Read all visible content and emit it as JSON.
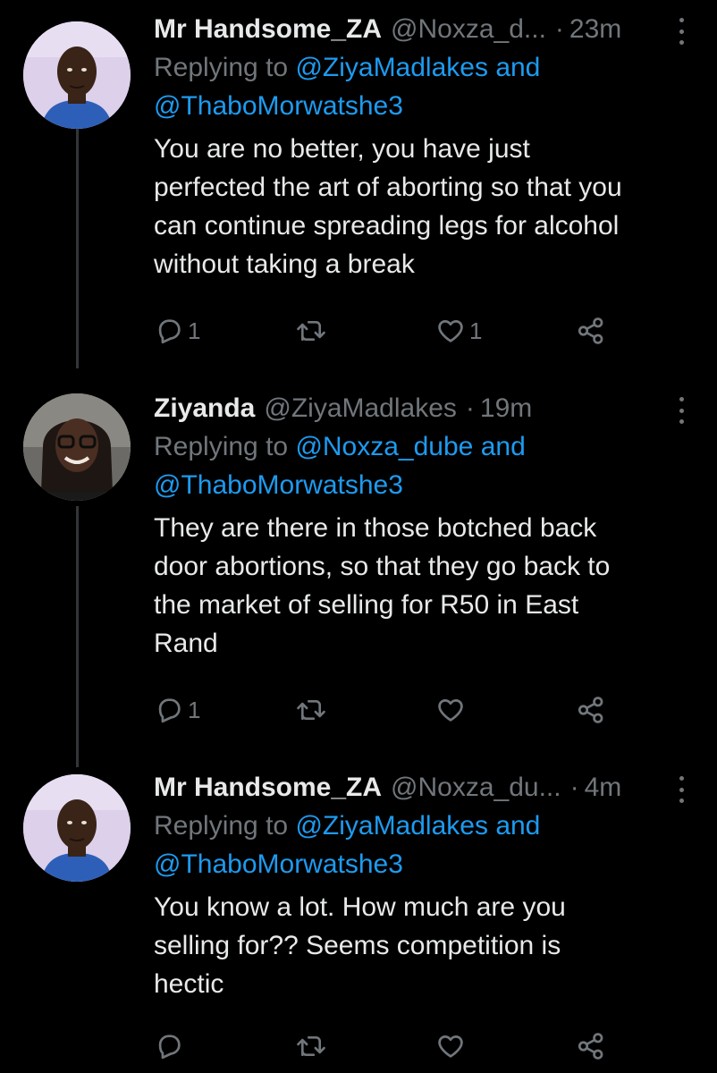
{
  "colors": {
    "background": "#000000",
    "text": "#e7e9ea",
    "muted": "#71767b",
    "mention": "#1d9bf0",
    "thread_line": "#333639"
  },
  "tweets": [
    {
      "name": "Mr Handsome_ZA",
      "handle": "@Noxza_d...",
      "separator": "·",
      "time": "23m",
      "replying_prefix": "Replying to",
      "mention_1": "@ZiyaMadlakes",
      "joiner": "and",
      "mention_2": "@ThaboMorwatshe3",
      "lines": [
        "You are no better, you have just",
        "perfected the art of aborting so that you",
        "can continue spreading legs for alcohol",
        "without taking a break"
      ],
      "reply_count": "1",
      "retweet_count": "",
      "like_count": "1",
      "avatar_icon": "user-avatar-icon"
    },
    {
      "name": "Ziyanda",
      "handle": "@ZiyaMadlakes",
      "separator": "·",
      "time": "19m",
      "replying_prefix": "Replying to",
      "mention_1": "@Noxza_dube",
      "joiner": "and",
      "mention_2": "@ThaboMorwatshe3",
      "lines": [
        "They are there in those botched back",
        "door abortions, so that they go back to",
        "the market of selling for R50 in East",
        "Rand"
      ],
      "reply_count": "1",
      "retweet_count": "",
      "like_count": "",
      "avatar_icon": "user-avatar-icon"
    },
    {
      "name": "Mr Handsome_ZA",
      "handle": "@Noxza_du...",
      "separator": "·",
      "time": "4m",
      "replying_prefix": "Replying to",
      "mention_1": "@ZiyaMadlakes",
      "joiner": "and",
      "mention_2": "@ThaboMorwatshe3",
      "lines": [
        "You know a lot. How much are you",
        "selling for??  Seems competition is",
        "hectic"
      ],
      "reply_count": "",
      "retweet_count": "",
      "like_count": "",
      "avatar_icon": "user-avatar-icon"
    }
  ],
  "icons": {
    "reply": "reply-icon",
    "retweet": "retweet-icon",
    "like": "like-icon",
    "share": "share-icon",
    "more": "more-options-icon"
  }
}
